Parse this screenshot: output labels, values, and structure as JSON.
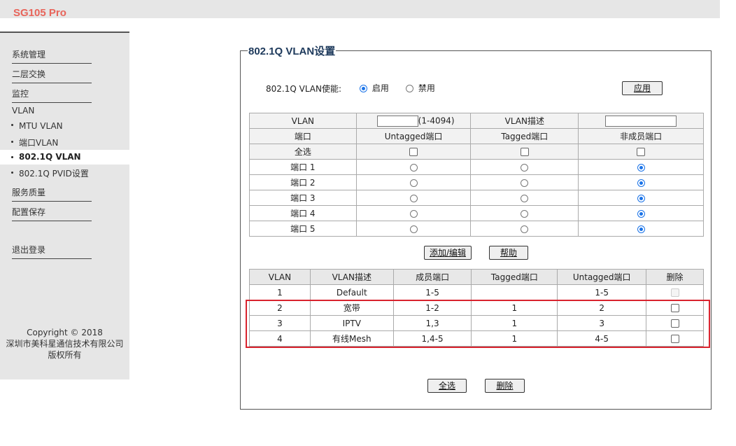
{
  "brand": "SG105 Pro",
  "sidebar": {
    "items": [
      "系统管理",
      "二层交换",
      "监控"
    ],
    "vlan_header": "VLAN",
    "sub_items": [
      "MTU VLAN",
      "端口VLAN",
      "802.1Q VLAN",
      "802.1Q PVID设置"
    ],
    "active_sub": "802.1Q VLAN",
    "items2": [
      "服务质量",
      "配置保存"
    ],
    "logout": "退出登录",
    "copyright": [
      "Copyright © 2018",
      "深圳市美科星通信技术有限公司",
      "版权所有"
    ]
  },
  "panel": {
    "title": "802.1Q VLAN设置",
    "enable_label": "802.1Q VLAN使能:",
    "enable_on": "启用",
    "enable_off": "禁用",
    "enable_selected": "启用",
    "apply_button": "应用"
  },
  "config_table": {
    "vlan_label": "VLAN",
    "vlan_range": "(1-4094)",
    "desc_label": "VLAN描述",
    "headers": [
      "端口",
      "Untagged端口",
      "Tagged端口",
      "非成员端口"
    ],
    "select_all": "全选",
    "ports": [
      {
        "name": "端口 1",
        "selected": "非成员端口"
      },
      {
        "name": "端口 2",
        "selected": "非成员端口"
      },
      {
        "name": "端口 3",
        "selected": "非成员端口"
      },
      {
        "name": "端口 4",
        "selected": "非成员端口"
      },
      {
        "name": "端口 5",
        "selected": "非成员端口"
      }
    ],
    "add_edit_button": "添加/编辑",
    "help_button": "帮助"
  },
  "vlan_list": {
    "headers": [
      "VLAN",
      "VLAN描述",
      "成员端口",
      "Tagged端口",
      "Untagged端口",
      "删除"
    ],
    "rows": [
      {
        "vlan": "1",
        "desc": "Default",
        "members": "1-5",
        "tagged": "",
        "untagged": "1-5",
        "deletable": false
      },
      {
        "vlan": "2",
        "desc": "宽带",
        "members": "1-2",
        "tagged": "1",
        "untagged": "2",
        "deletable": true
      },
      {
        "vlan": "3",
        "desc": "IPTV",
        "members": "1,3",
        "tagged": "1",
        "untagged": "3",
        "deletable": true
      },
      {
        "vlan": "4",
        "desc": "有线Mesh",
        "members": "1,4-5",
        "tagged": "1",
        "untagged": "4-5",
        "deletable": true
      }
    ],
    "select_all_button": "全选",
    "delete_button": "删除"
  },
  "colors": {
    "brand": "#e8645a",
    "highlight": "#d9232e",
    "radio_selected": "#1a73e8"
  }
}
